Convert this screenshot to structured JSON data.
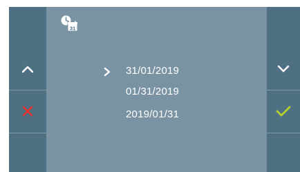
{
  "header": {
    "icon": "clock-calendar-icon",
    "calendar_day": "31"
  },
  "left_panel": {
    "up_button": "chevron-up-icon",
    "cancel_button": "cross-icon"
  },
  "right_panel": {
    "down_button": "chevron-down-icon",
    "confirm_button": "check-icon"
  },
  "date_formats": {
    "selected_index": 0,
    "options": [
      "31/01/2019",
      "01/31/2019",
      "2019/01/31"
    ]
  },
  "colors": {
    "panel": "#4f7083",
    "center": "#7993a2",
    "cancel": "#e2322f",
    "confirm": "#b4d22a",
    "text": "#ffffff"
  }
}
